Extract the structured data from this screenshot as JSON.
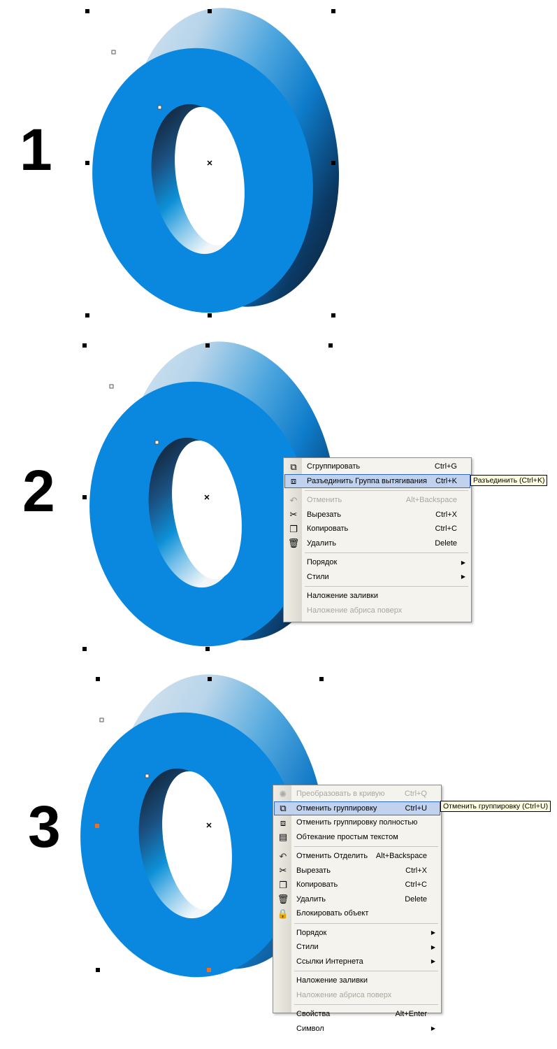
{
  "panels": [
    {
      "step": "1",
      "menu": null,
      "tooltip": null
    },
    {
      "step": "2",
      "menu": {
        "items": [
          {
            "type": "item",
            "icon": "group-icon",
            "label": "Сгруппировать",
            "shortcut": "Ctrl+G",
            "state": "normal"
          },
          {
            "type": "item",
            "icon": "break-apart-icon",
            "label": "Разъединить Группа вытягивания",
            "shortcut": "Ctrl+K",
            "state": "hover"
          },
          {
            "type": "sep"
          },
          {
            "type": "item",
            "icon": "undo-icon",
            "label": "Отменить",
            "shortcut": "Alt+Backspace",
            "state": "disabled"
          },
          {
            "type": "item",
            "icon": "cut-icon",
            "label": "Вырезать",
            "shortcut": "Ctrl+X",
            "state": "normal"
          },
          {
            "type": "item",
            "icon": "copy-icon",
            "label": "Копировать",
            "shortcut": "Ctrl+C",
            "state": "normal"
          },
          {
            "type": "item",
            "icon": "delete-icon",
            "label": "Удалить",
            "shortcut": "Delete",
            "state": "normal"
          },
          {
            "type": "sep"
          },
          {
            "type": "item",
            "icon": "",
            "label": "Порядок",
            "shortcut": "",
            "submenu": true,
            "state": "normal"
          },
          {
            "type": "item",
            "icon": "",
            "label": "Стили",
            "shortcut": "",
            "submenu": true,
            "state": "normal"
          },
          {
            "type": "sep"
          },
          {
            "type": "item",
            "icon": "",
            "label": "Наложение заливки",
            "shortcut": "",
            "state": "normal"
          },
          {
            "type": "item",
            "icon": "",
            "label": "Наложение абриса поверх",
            "shortcut": "",
            "state": "disabled"
          }
        ]
      },
      "tooltip": "Разъединить (Ctrl+K)"
    },
    {
      "step": "3",
      "menu": {
        "items": [
          {
            "type": "item",
            "icon": "convert-to-curves-icon",
            "label": "Преобразовать в кривую",
            "shortcut": "Ctrl+Q",
            "state": "disabled"
          },
          {
            "type": "item",
            "icon": "ungroup-icon",
            "label": "Отменить группировку",
            "shortcut": "Ctrl+U",
            "state": "hover"
          },
          {
            "type": "item",
            "icon": "ungroup-all-icon",
            "label": "Отменить группировку полностью",
            "shortcut": "",
            "state": "normal"
          },
          {
            "type": "item",
            "icon": "text-wrap-icon",
            "label": "Обтекание простым текстом",
            "shortcut": "",
            "state": "normal"
          },
          {
            "type": "sep"
          },
          {
            "type": "item",
            "icon": "undo-icon",
            "label": "Отменить Отделить",
            "shortcut": "Alt+Backspace",
            "state": "normal"
          },
          {
            "type": "item",
            "icon": "cut-icon",
            "label": "Вырезать",
            "shortcut": "Ctrl+X",
            "state": "normal"
          },
          {
            "type": "item",
            "icon": "copy-icon",
            "label": "Копировать",
            "shortcut": "Ctrl+C",
            "state": "normal"
          },
          {
            "type": "item",
            "icon": "delete-icon",
            "label": "Удалить",
            "shortcut": "Delete",
            "state": "normal"
          },
          {
            "type": "item",
            "icon": "lock-icon",
            "label": "Блокировать объект",
            "shortcut": "",
            "state": "normal"
          },
          {
            "type": "sep"
          },
          {
            "type": "item",
            "icon": "",
            "label": "Порядок",
            "shortcut": "",
            "submenu": true,
            "state": "normal"
          },
          {
            "type": "item",
            "icon": "",
            "label": "Стили",
            "shortcut": "",
            "submenu": true,
            "state": "normal"
          },
          {
            "type": "item",
            "icon": "",
            "label": "Ссылки Интернета",
            "shortcut": "",
            "submenu": true,
            "state": "normal"
          },
          {
            "type": "sep"
          },
          {
            "type": "item",
            "icon": "",
            "label": "Наложение заливки",
            "shortcut": "",
            "state": "normal"
          },
          {
            "type": "item",
            "icon": "",
            "label": "Наложение абриса поверх",
            "shortcut": "",
            "state": "disabled"
          },
          {
            "type": "sep"
          },
          {
            "type": "item",
            "icon": "",
            "label": "Свойства",
            "shortcut": "Alt+Enter",
            "state": "normal"
          },
          {
            "type": "item",
            "icon": "",
            "label": "Символ",
            "shortcut": "",
            "submenu": true,
            "state": "normal"
          }
        ]
      },
      "tooltip": "Отменить группировку (Ctrl+U)"
    }
  ],
  "colors": {
    "face": "#0a88e0",
    "hover_bg": "#c1d2ee",
    "hover_border": "#316ac5",
    "menu_bg": "#f4f3ee",
    "tooltip_bg": "#ffffe1",
    "anchor_selected": "#f07020"
  }
}
